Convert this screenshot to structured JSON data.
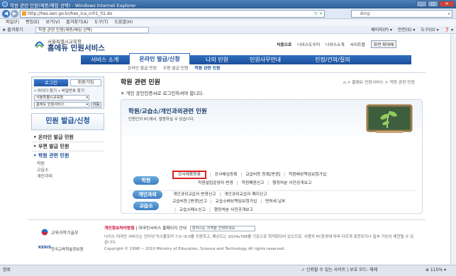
{
  "browser": {
    "title": "학원 관련 민원(제증/해임 선택) - Windows Internet Explorer",
    "address": "http://hes.sen.go.kr/hes_ica_cr01_01.do",
    "search_placeholder": "Bing",
    "menu": [
      "파일(F)",
      "편집(E)",
      "보기(V)",
      "즐겨찾기(A)",
      "도구(T)",
      "도움말(H)"
    ],
    "favorites_label": "즐겨찾기",
    "tab_title": "학원 관련 민원(제증/해임 선택)",
    "tools": [
      "페이지(P) ▾",
      "안전(S) ▾",
      "도구(O) ▾",
      "❓ ▾"
    ]
  },
  "site": {
    "logo_sub": "서울특별시교육청",
    "logo_main": "홈에듀 민원서비스",
    "toplinks": [
      "처음으로",
      "나이스도우미",
      "나이스소개",
      "사이트맵"
    ],
    "toplink_button": "화면 확대해",
    "gnb": [
      "서비스 소개",
      "온라인 발급/신청",
      "나의 민원",
      "민원사무안내",
      "진정/건의/질의"
    ],
    "lnb": [
      "온라인 발급 민원",
      "우편 발급 민원",
      "학원 관련 민원"
    ]
  },
  "sidebar": {
    "login_button": "로그인",
    "join_button": "회원가입",
    "find_links": "• 아이디 찾기  • 비밀번호 찾기",
    "select1": "서울특별시교육청",
    "select2": "홈에듀 민원서비스",
    "go_button": "이동",
    "title": "민원 발급/신청",
    "menu": [
      "• 온라인 발급 민원",
      "• 우편 발급 민원",
      "• 학원 관련 민원"
    ],
    "submenu": [
      "학원",
      "교습소",
      "개인과외"
    ]
  },
  "main": {
    "title": "학원 관련 민원",
    "breadcrumb": "⌂ > 홈에듀 민원서비스 > 학원 관련 민원",
    "notice": "✕ 개인 공인인증서로 로그인하셔야 합니다.",
    "panel_title": "학원/교습소/개인과외관련 민원",
    "panel_desc": "인원인의 PC에서, 열람하실 수 있습니다.",
    "categories": [
      {
        "name": "학원",
        "row1": [
          "강사채용등록",
          "강사해임등록",
          "교습비등 등록[변경]",
          "학원배상책임보험가입"
        ],
        "row2": [
          "학원설립운영자 변경",
          "학원폐원신고",
          "행정처분 사전공개보고"
        ]
      },
      {
        "name": "교습소",
        "row1": [
          "교습비등 [변경]신고",
          "교습소배상책임보험가입",
          "면허세 납부"
        ],
        "row2": [
          "교습소폐소신고",
          "행정처분 사전공개보고"
        ]
      },
      {
        "name": "개인과외",
        "row1": [
          "개인과외교습자 변경신고",
          "개인과외교습자 폐지신고"
        ],
        "row2": []
      }
    ]
  },
  "footer": {
    "org1": "교육과학기술부",
    "org2": "한국교육학술정보원",
    "kerris": "KERIS",
    "policy": "개인정보처리방침",
    "link2": "대국민서비스 홈페이지 안내",
    "select": "원하시는 지역을 선택하세요.",
    "text": "나이스 대국민 서비스는 인터넷 익스플로러 7.0~8.0를 지원하고, 해상도는 1024x768를 기준으로 최적화되어 있으므로, 사용자 PC환경에 따라 다르게 표현되거나 일부 기능이 제한될 수 있습니다.",
    "copyright": "Copyright © 1998 ~ 2010 Ministry of Education, Science and Technology All rights reserved."
  },
  "status": {
    "left": "완료",
    "trusted": "✓ 신뢰할 수 있는 사이트 | 보호 모드: 해제",
    "zoom": "⊕ 115% ▾"
  },
  "colors": {
    "accent": "#1c4f9a",
    "highlight": "#e02020"
  }
}
